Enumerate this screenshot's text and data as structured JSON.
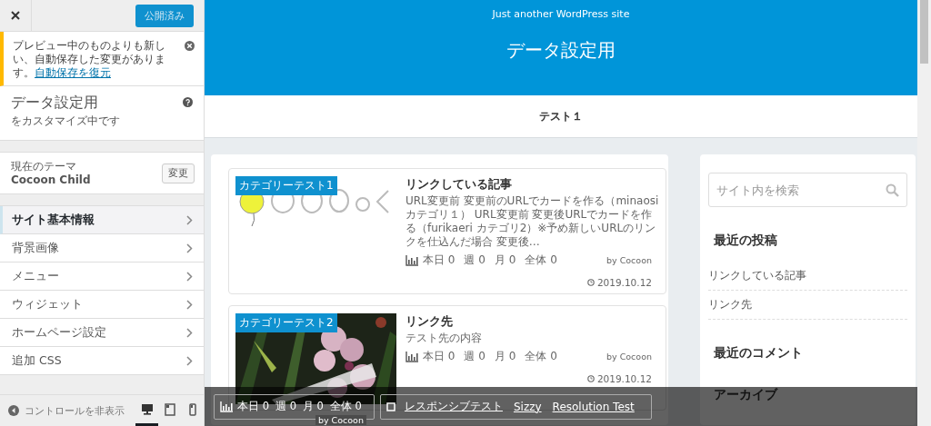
{
  "customizer": {
    "publish_button": "公開済み",
    "notice": {
      "text": "プレビュー中のものよりも新しい、自動保存した変更があります。",
      "link": "自動保存を復元"
    },
    "title": "データ設定用",
    "subtitle": "をカスタマイズ中です",
    "theme": {
      "label": "現在のテーマ",
      "name": "Cocoon Child",
      "button": "変更"
    },
    "sections": [
      {
        "label": "サイト基本情報",
        "selected": true
      },
      {
        "label": "背景画像",
        "selected": false
      },
      {
        "label": "メニュー",
        "selected": false
      },
      {
        "label": "ウィジェット",
        "selected": false
      },
      {
        "label": "ホームページ設定",
        "selected": false
      },
      {
        "label": "追加 CSS",
        "selected": false
      }
    ],
    "footer": {
      "hide_label": "コントロールを非表示",
      "devices": [
        {
          "kind": "desktop",
          "selected": true
        },
        {
          "kind": "tablet",
          "selected": false
        },
        {
          "kind": "mobile",
          "selected": false
        }
      ]
    }
  },
  "preview": {
    "tagline": "Just another WordPress site",
    "site_title": "データ設定用",
    "nav": [
      {
        "label": "テスト１"
      }
    ],
    "posts": [
      {
        "category": "カテゴリーテスト1",
        "title": "リンクしている記事",
        "excerpt": "URL変更前 変更前のURLでカードを作る（minaosi カテゴリ１） URL変更前 変更後URLでカードを作る（furikaeri カテゴリ2）※予め新しいURLのリンクを仕込んだ場合 変更後…",
        "stats": [
          "本日 0",
          "週 0",
          "月 0",
          "全体 0"
        ],
        "credit": "by Cocoon",
        "date": "2019.10.12"
      },
      {
        "category": "カテゴリーテスト2",
        "title": "リンク先",
        "excerpt": "テスト先の内容",
        "stats": [
          "本日 0",
          "週 0",
          "月 0",
          "全体 0"
        ],
        "credit": "by Cocoon",
        "date": "2019.10.12"
      }
    ],
    "search": {
      "placeholder": "サイト内を検索"
    },
    "widgets": [
      {
        "title": "最近の投稿",
        "items": [
          "リンクしている記事",
          "リンク先"
        ]
      },
      {
        "title": "最近のコメント"
      },
      {
        "title": "アーカイブ"
      }
    ],
    "toolbar": {
      "stats": [
        "本日 0",
        "週 0",
        "月 0",
        "全体 0"
      ],
      "credit": "by Cocoon",
      "links": [
        "レスポンシブテスト",
        "Sizzy",
        "Resolution Test"
      ]
    }
  }
}
